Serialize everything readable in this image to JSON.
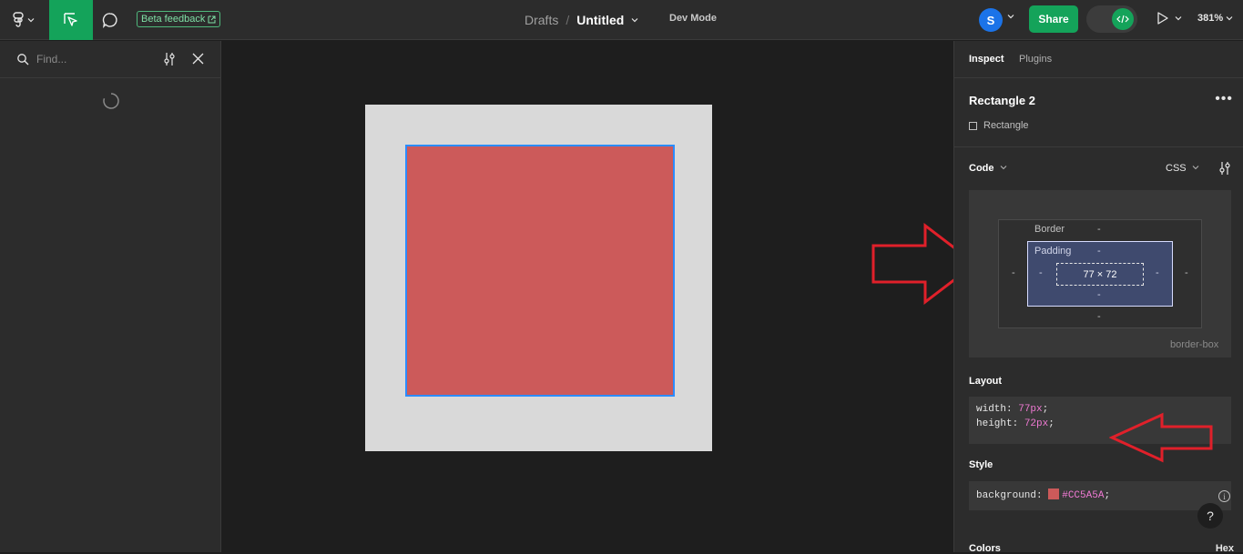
{
  "toolbar": {
    "beta_label": "Beta feedback",
    "drafts": "Drafts",
    "separator": "/",
    "file_title": "Untitled",
    "dev_mode": "Dev Mode",
    "avatar_initial": "S",
    "share_label": "Share",
    "zoom": "381%"
  },
  "left_panel": {
    "search_placeholder": "Find..."
  },
  "right_panel": {
    "tabs": [
      "Inspect",
      "Plugins"
    ],
    "selection_name": "Rectangle 2",
    "selection_type": "Rectangle",
    "code_label": "Code",
    "language": "CSS",
    "box_model": {
      "border_label": "Border",
      "padding_label": "Padding",
      "content_size": "77 × 72",
      "dash": "-",
      "sizing": "border-box"
    },
    "layout_title": "Layout",
    "layout_code": [
      {
        "prop": "width: ",
        "value": "77px",
        "end": ";"
      },
      {
        "prop": "height: ",
        "value": "72px",
        "end": ";"
      }
    ],
    "style_title": "Style",
    "style_prop": "background: ",
    "style_value": "#CC5A5A",
    "style_end": ";",
    "colors_title": "Colors",
    "colors_format": "Hex"
  },
  "colors": {
    "accent_green": "#14a35a",
    "rect_fill": "#cc5a5a",
    "selection_blue": "#2b8cff",
    "annotation_red": "#e0202a"
  }
}
